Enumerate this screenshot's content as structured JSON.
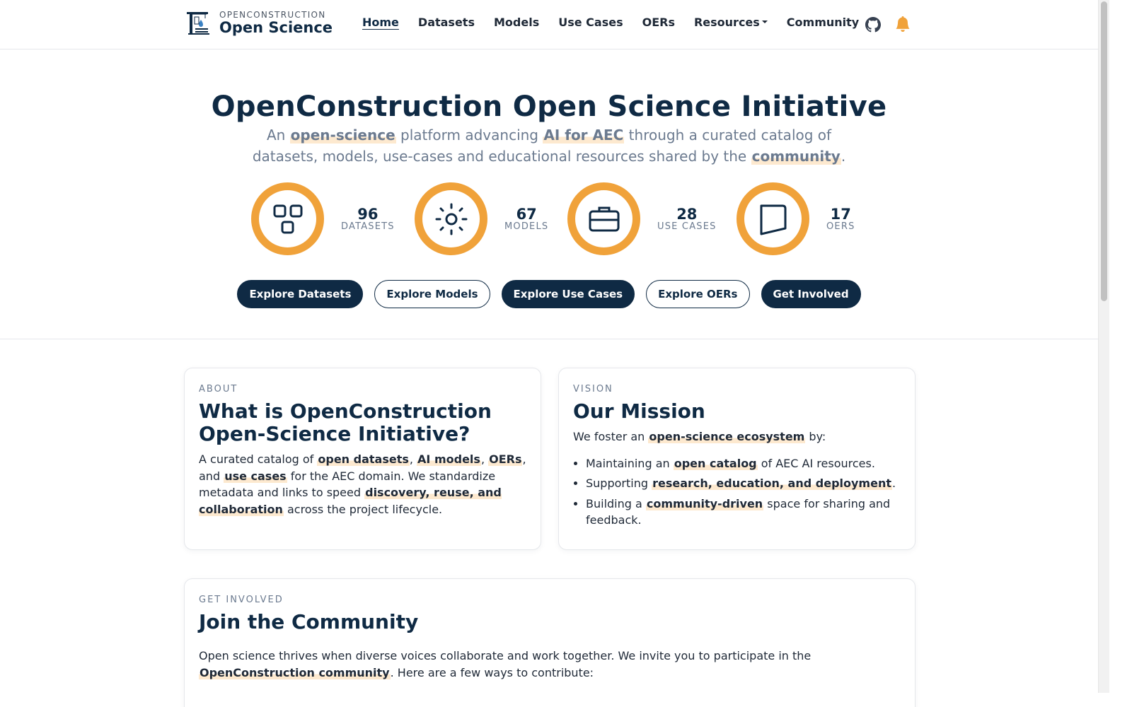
{
  "nav": {
    "brand_small": "OPENCONSTRUCTION",
    "brand_big": "Open Science",
    "links": [
      {
        "label": "Home",
        "active": true
      },
      {
        "label": "Datasets"
      },
      {
        "label": "Models"
      },
      {
        "label": "Use Cases"
      },
      {
        "label": "OERs"
      },
      {
        "label": "Resources",
        "dropdown": true
      },
      {
        "label": "Community"
      }
    ],
    "icons": [
      "github-icon",
      "bell-icon"
    ],
    "bell_color": "#f0a23a"
  },
  "hero": {
    "title": "OpenConstruction Open Science Initiative",
    "subtitle": {
      "p1": "An ",
      "h1": "open-science",
      "p2": " platform advancing ",
      "h2": "AI for AEC",
      "p3": " through a curated catalog of datasets, models, use-cases and educational resources shared by the ",
      "h3": "community",
      "p4": "."
    },
    "stats": [
      {
        "value": "96",
        "label": "DATASETS",
        "icon": "grid-icon"
      },
      {
        "value": "67",
        "label": "MODELS",
        "icon": "sun-icon"
      },
      {
        "value": "28",
        "label": "USE CASES",
        "icon": "briefcase-icon"
      },
      {
        "value": "17",
        "label": "OERS",
        "icon": "book-icon"
      }
    ],
    "buttons": [
      {
        "label": "Explore Datasets",
        "style": "solid"
      },
      {
        "label": "Explore Models",
        "style": "outline"
      },
      {
        "label": "Explore Use Cases",
        "style": "solid"
      },
      {
        "label": "Explore OERs",
        "style": "outline"
      },
      {
        "label": "Get Involved",
        "style": "solid"
      }
    ]
  },
  "about": {
    "eyebrow": "ABOUT",
    "title": "What is OpenConstruction Open-Science Initiative?",
    "body": {
      "p1": "A curated catalog of ",
      "h1": "open datasets",
      "p2": ", ",
      "h2": "AI models",
      "p3": ", ",
      "h3": "OERs",
      "p4": ", and ",
      "h4": "use cases",
      "p5": " for the AEC domain. We standardize metadata and links to speed ",
      "h5": "discovery, reuse, and collaboration",
      "p6": " across the project lifecycle."
    }
  },
  "vision": {
    "eyebrow": "VISION",
    "title": "Our Mission",
    "intro": {
      "p1": "We foster an ",
      "h1": "open-science ecosystem",
      "p2": " by:"
    },
    "items": [
      {
        "p1": "Maintaining an ",
        "h1": "open catalog",
        "p2": " of AEC AI resources."
      },
      {
        "p1": "Supporting ",
        "h1": "research, education, and deployment",
        "p2": "."
      },
      {
        "p1": "Building a ",
        "h1": "community-driven",
        "p2": " space for sharing and feedback."
      }
    ]
  },
  "involved": {
    "eyebrow": "GET INVOLVED",
    "title": "Join the Community",
    "body": {
      "p1": "Open science thrives when diverse voices collaborate and work together. We invite you to participate in the ",
      "h1": "OpenConstruction community",
      "p2": ". Here are a few ways to contribute:"
    }
  },
  "colors": {
    "navy": "#0f2a44",
    "accent": "#f0a23a",
    "highlight": "#fde9cf"
  }
}
